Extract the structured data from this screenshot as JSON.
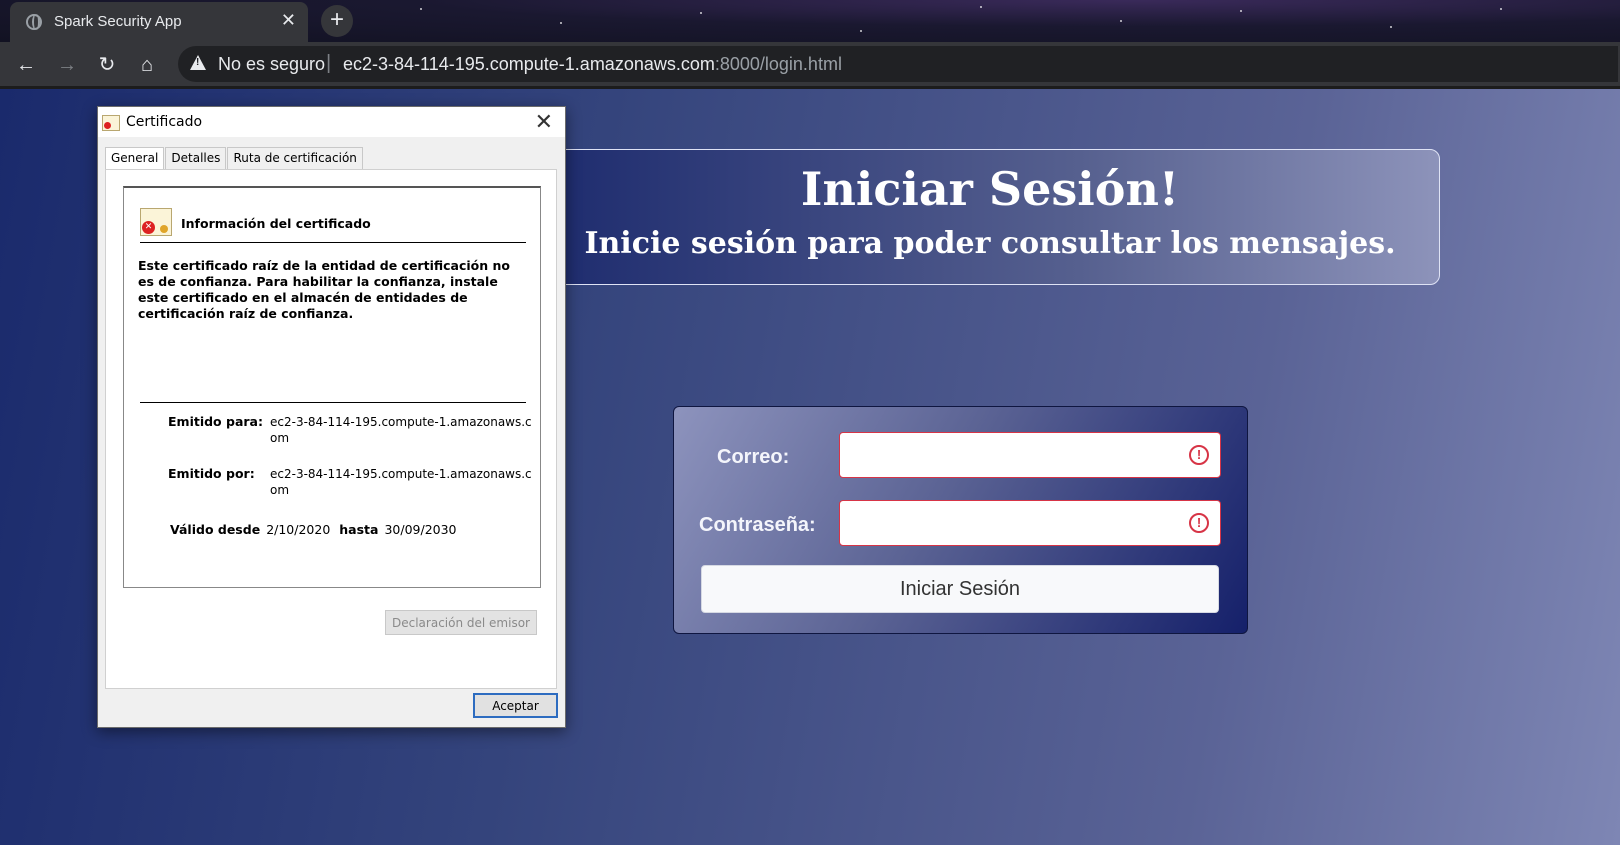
{
  "browser": {
    "tab_title": "Spark Security App",
    "tab_close": "✕",
    "new_tab": "+",
    "back_icon": "←",
    "forward_icon": "→",
    "reload_icon": "↻",
    "home_icon": "⌂",
    "security_label": "No es seguro",
    "url_separator": "|",
    "url_host": "ec2-3-84-114-195.compute-1.amazonaws.com",
    "url_path": ":8000/login.html"
  },
  "page": {
    "hero_title": "Iniciar Sesión!",
    "hero_subtitle": "Inicie sesión para poder consultar los mensajes.",
    "login": {
      "email_label": "Correo:",
      "email_value": "",
      "password_label": "Contraseña:",
      "password_value": "",
      "invalid_mark": "!",
      "submit_label": "Iniciar Sesión"
    }
  },
  "dialog": {
    "title": "Certificado",
    "close": "✕",
    "tabs": [
      "General",
      "Detalles",
      "Ruta de certificación"
    ],
    "heading": "Información del certificado",
    "warning": "Este certificado raíz de la entidad de certificación no es de confianza. Para habilitar la confianza, instale este certificado en el almacén de entidades de certificación raíz de confianza.",
    "issued_to_label": "Emitido para:",
    "issued_to_value": "ec2-3-84-114-195.compute-1.amazonaws.com",
    "issued_by_label": "Emitido por:",
    "issued_by_value": "ec2-3-84-114-195.compute-1.amazonaws.com",
    "valid_from_label": "Válido desde",
    "valid_from_value": "2/10/2020",
    "valid_to_label": "hasta",
    "valid_to_value": "30/09/2030",
    "issuer_statement_button": "Declaración del emisor",
    "ok_button": "Aceptar"
  }
}
